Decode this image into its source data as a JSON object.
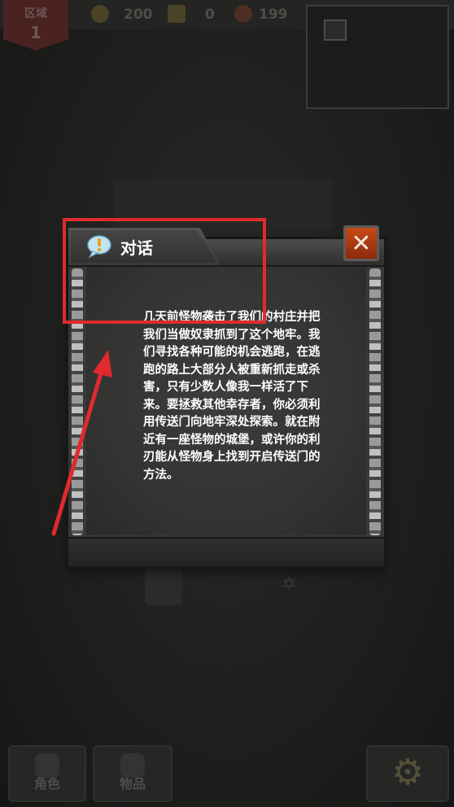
{
  "hud": {
    "zone_label": "区域",
    "zone_number": "1",
    "coins": "200",
    "crowns": "0",
    "meat": "199"
  },
  "dialog": {
    "title": "对话",
    "close_glyph": "✕",
    "text": "几天前怪物袭击了我们的村庄并把我们当做奴隶抓到了这个地牢。我们寻找各种可能的机会逃跑，在逃跑的路上大部分人被重新抓走或杀害，只有少数人像我一样活了下来。要拯救其他幸存者，你必须利用传送门向地牢深处探索。就在附近有一座怪物的城堡，或许你的利刃能从怪物身上找到开启传送门的方法。"
  },
  "bottom_menu": {
    "character": "角色",
    "items": "物品"
  },
  "colors": {
    "annotation_red": "#e02a2e",
    "close_button": "#c84a17",
    "zone_badge": "#4a2220"
  }
}
